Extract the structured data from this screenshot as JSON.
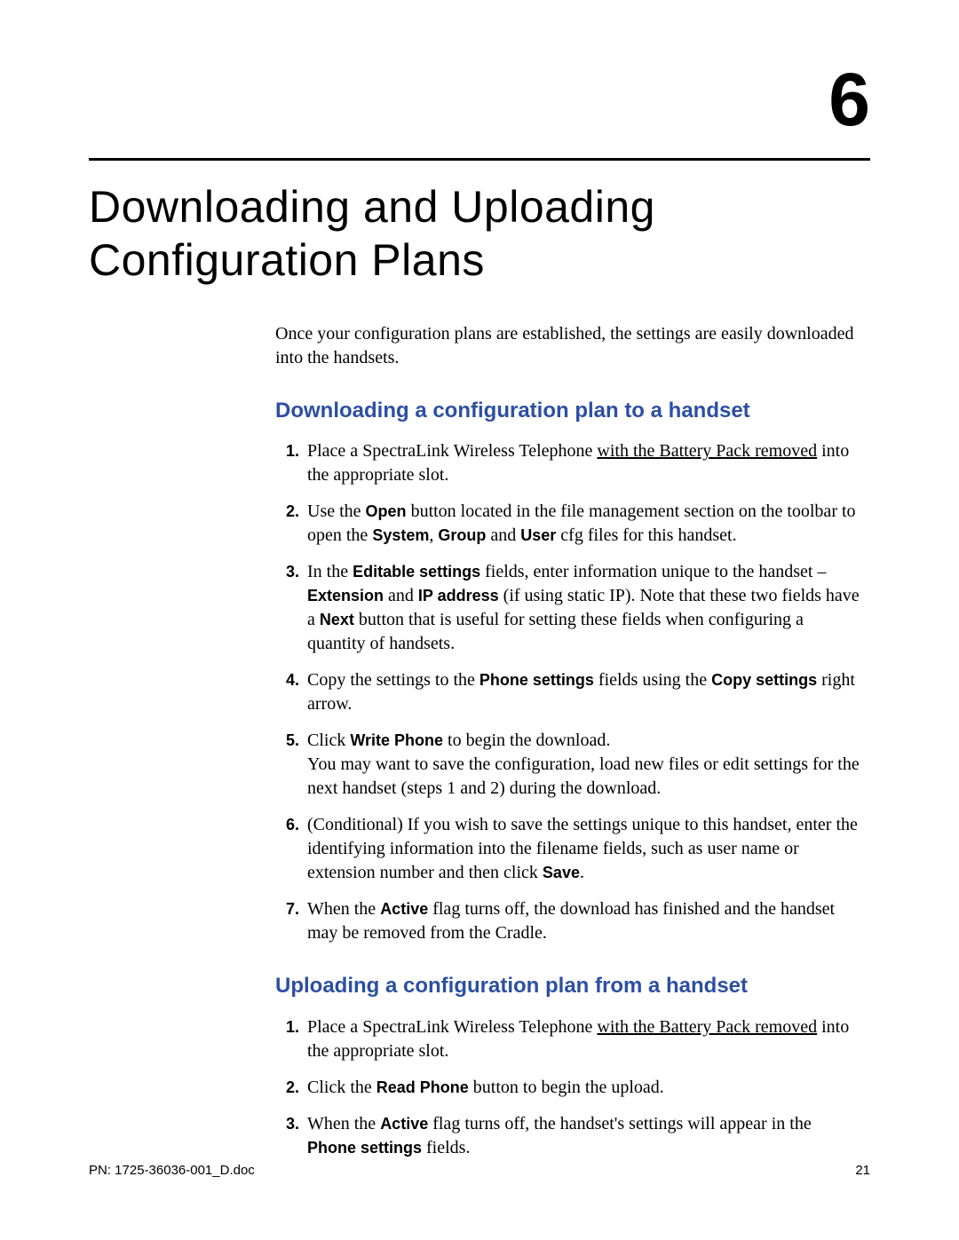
{
  "chapter_number": "6",
  "chapter_title": "Downloading and Uploading Configuration Plans",
  "intro": "Once your configuration plans are established, the settings are easily downloaded into the handsets.",
  "section_download": {
    "heading": "Downloading a configuration plan to a handset",
    "steps": {
      "s1_a": "Place a SpectraLink Wireless Telephone ",
      "s1_u": "with the Battery Pack removed",
      "s1_b": " into the appropriate slot.",
      "s2_a": "Use the ",
      "s2_open": "Open",
      "s2_b": " button located in the file management section on the toolbar to open the ",
      "s2_system": "System",
      "s2_comma": ", ",
      "s2_group": "Group",
      "s2_and": " and ",
      "s2_user": "User",
      "s2_c": " cfg files for this handset.",
      "s3_a": "In the ",
      "s3_edit": "Editable settings",
      "s3_b": " fields, enter information unique to the handset – ",
      "s3_ext": "Extension",
      "s3_and": " and ",
      "s3_ip": "IP address",
      "s3_c": " (if using static IP). Note that these two fields have a ",
      "s3_next": "Next",
      "s3_d": " button that is useful for setting these fields when configuring a quantity of handsets.",
      "s4_a": "Copy the settings to the ",
      "s4_ps": "Phone settings",
      "s4_b": " fields using the ",
      "s4_cs": "Copy settings",
      "s4_c": " right arrow.",
      "s5_a": "Click ",
      "s5_wp": "Write Phone",
      "s5_b": " to begin the download.",
      "s5_c": "You may want to save the configuration, load new files or edit settings for the next handset (steps 1 and 2) during the download.",
      "s6_a": "(Conditional) If you wish to save the settings unique to this handset, enter the identifying information into the filename fields, such as user name or extension number and then click ",
      "s6_save": "Save",
      "s6_b": ".",
      "s7_a": "When the ",
      "s7_active": "Active",
      "s7_b": " flag turns off, the download has finished and the handset may be removed from the Cradle."
    }
  },
  "section_upload": {
    "heading": "Uploading a configuration plan from a handset",
    "steps": {
      "s1_a": "Place a SpectraLink Wireless Telephone ",
      "s1_u": "with the Battery Pack removed",
      "s1_b": " into the appropriate slot.",
      "s2_a": "Click the ",
      "s2_rp": "Read Phone",
      "s2_b": " button to begin the upload.",
      "s3_a": "When the ",
      "s3_active": "Active",
      "s3_b": " flag turns off, the handset's settings will appear in the ",
      "s3_ps": "Phone settings",
      "s3_c": " fields."
    }
  },
  "footer": {
    "left": "PN: 1725-36036-001_D.doc",
    "right": "21"
  }
}
